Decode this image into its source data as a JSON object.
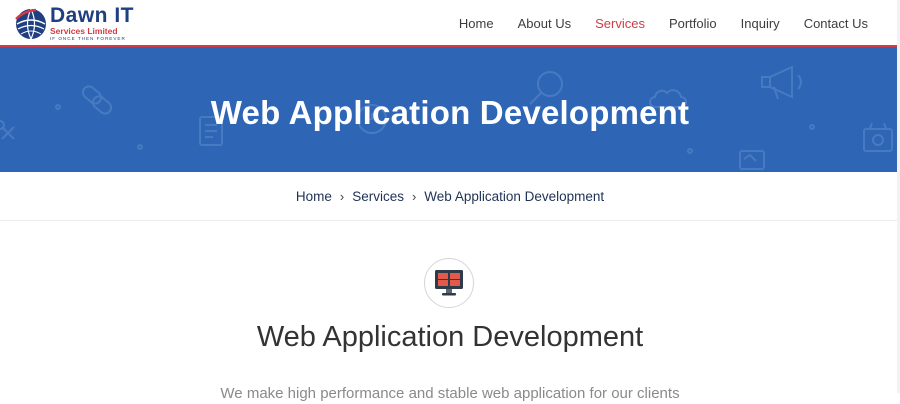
{
  "brand": {
    "name": "Dawn IT",
    "sub": "Services Limited",
    "tagline": "IF ONCE THEN FOREVER"
  },
  "nav": {
    "items": [
      {
        "label": "Home"
      },
      {
        "label": "About Us"
      },
      {
        "label": "Services",
        "active": true
      },
      {
        "label": "Portfolio"
      },
      {
        "label": "Inquiry"
      },
      {
        "label": "Contact Us"
      }
    ]
  },
  "banner": {
    "title": "Web Application Development"
  },
  "breadcrumb": {
    "home": "Home",
    "services": "Services",
    "current": "Web Application Development",
    "separator": "›"
  },
  "main": {
    "icon": "monitor-icon",
    "title": "Web Application Development",
    "intro": "We make high performance and stable web application for our clients"
  },
  "colors": {
    "accent": "#d23b45",
    "brand": "#1f3f82",
    "banner": "#2e66b5"
  }
}
